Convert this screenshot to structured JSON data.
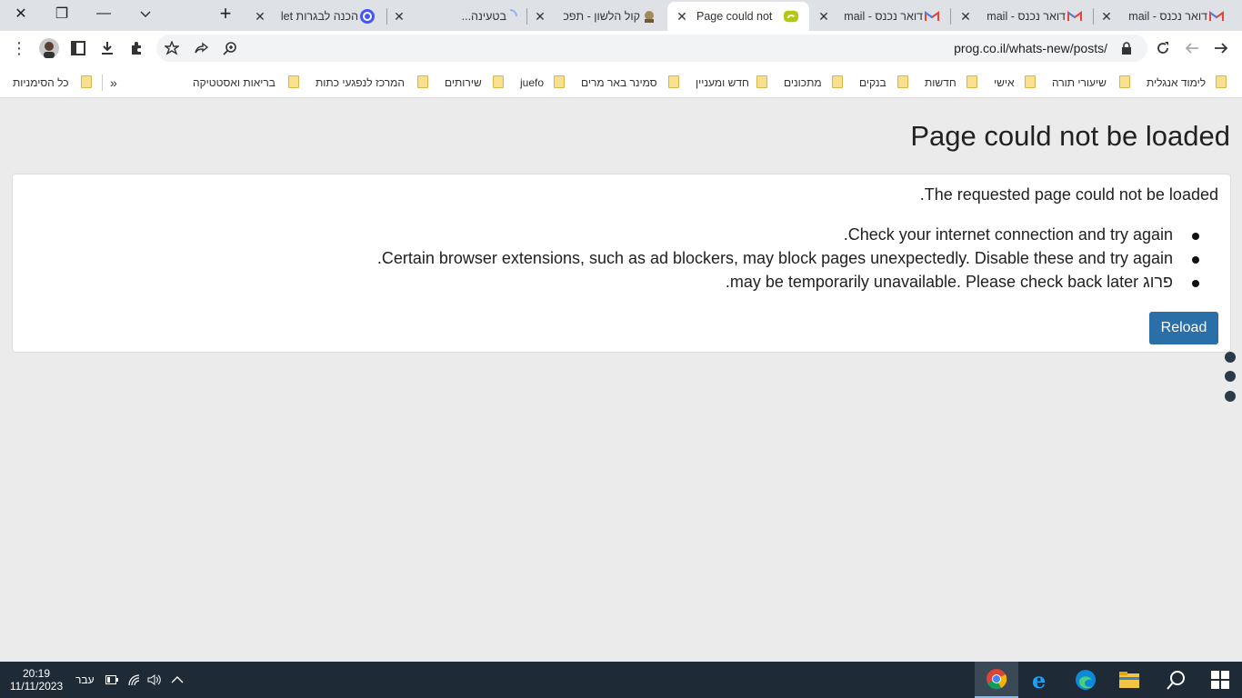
{
  "browser": {
    "window_controls": {
      "close": "✕",
      "restore": "❐",
      "minimize": "—",
      "tab_search": "⌄"
    },
    "new_tab": "+",
    "tabs": [
      {
        "title": "דואר נכנס - mail",
        "favicon": "gmail-icon"
      },
      {
        "title": "דואר נכנס - mail",
        "favicon": "gmail-icon"
      },
      {
        "title": "דואר נכנס - mail",
        "favicon": "gmail-icon"
      },
      {
        "title": "Page could not be loaded",
        "favicon": "error-icon",
        "active": true
      },
      {
        "title": "קול הלשון - תפכ",
        "favicon": "site-icon"
      },
      {
        "title": "בטעינה...",
        "favicon": "loading-icon"
      },
      {
        "title": "הכנה לבגרות let",
        "favicon": "quizlet-icon"
      }
    ],
    "url": "prog.co.il/whats-new/posts/",
    "bookmarks": [
      "לימוד אנגלית",
      "שיעורי תורה",
      "אישי",
      "חדשות",
      "בנקים",
      "מתכונים",
      "חדש ומעניין",
      "סמינר באר מרים",
      "juefo",
      "שירותים",
      "המרכז לנפגעי כתות",
      "בריאות ואסטטיקה"
    ],
    "bookmarks_overflow": "»",
    "all_bookmarks": "כל הסימניות"
  },
  "page": {
    "title": "Page could not be loaded",
    "message": "The requested page could not be loaded.",
    "bullets": [
      "Check your internet connection and try again.",
      "Certain browser extensions, such as ad blockers, may block pages unexpectedly. Disable these and try again.",
      "פרוג may be temporarily unavailable. Please check back later."
    ],
    "reload_label": "Reload"
  },
  "taskbar": {
    "time": "20:19",
    "date": "11/11/2023",
    "language": "עבר"
  }
}
